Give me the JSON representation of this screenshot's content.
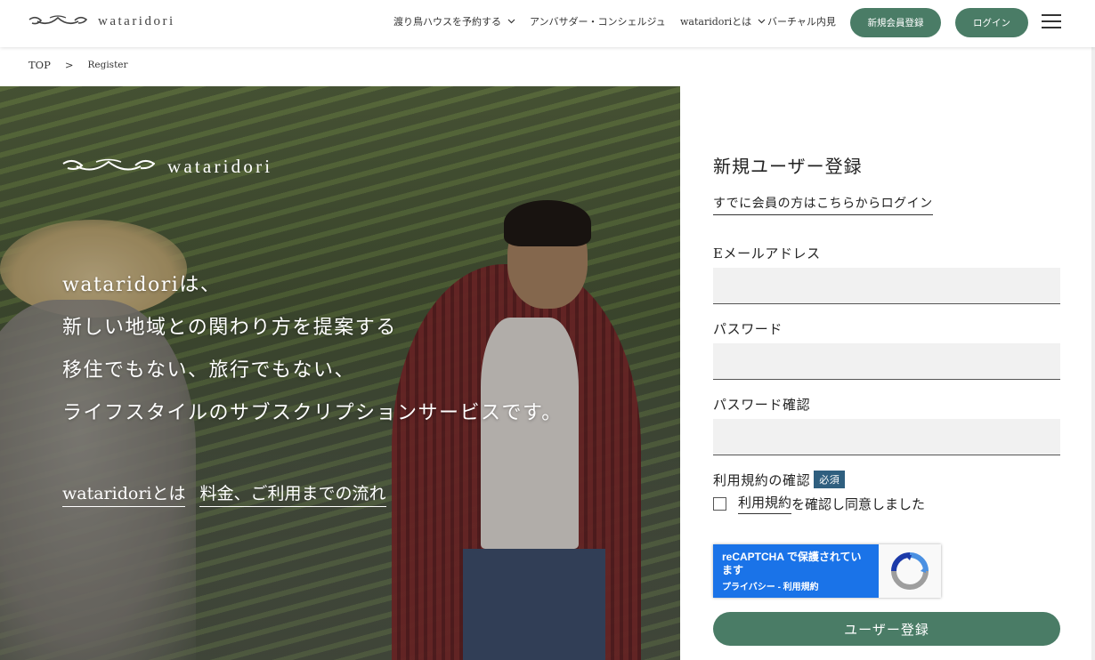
{
  "header": {
    "logo_text": "wataridori",
    "nav": [
      {
        "label": "渡り鳥ハウスを予約する",
        "has_dropdown": true
      },
      {
        "label": "アンバサダー・コンシェルジュ",
        "has_dropdown": false
      },
      {
        "label": "wataridoriとは",
        "has_dropdown": true
      },
      {
        "label": "バーチャル内見",
        "has_dropdown": false
      }
    ],
    "register_button": "新規会員登録",
    "login_button": "ログイン",
    "menu_icon": "hamburger-icon"
  },
  "breadcrumb": {
    "top": "TOP",
    "separator": ">",
    "current": "Register"
  },
  "hero": {
    "logo_text": "wataridori",
    "copy_lines": [
      "wataridoriは、",
      "新しい地域との関わり方を提案する",
      "移住でもない、旅行でもない、",
      "ライフスタイルのサブスクリプションサービスです。"
    ],
    "links": [
      "wataridoriとは",
      "料金、ご利用までの流れ"
    ]
  },
  "form": {
    "title": "新規ユーザー登録",
    "login_link": "すでに会員の方はこちらからログイン",
    "email_label": "Eメールアドレス",
    "email_value": "",
    "password_label": "パスワード",
    "password_value": "",
    "password_confirm_label": "パスワード確認",
    "password_confirm_value": "",
    "terms_label": "利用規約の確認",
    "required_badge": "必須",
    "terms_link": "利用規約",
    "terms_agree_text": "を確認し同意しました",
    "terms_checked": false,
    "recaptcha_title": "reCAPTCHA で保護されています",
    "recaptcha_links": "プライバシー - 利用規約",
    "submit_label": "ユーザー登録"
  },
  "colors": {
    "accent_green": "#4a7c66",
    "required_badge": "#2f5f7f",
    "recaptcha_blue": "#1a73e8"
  }
}
